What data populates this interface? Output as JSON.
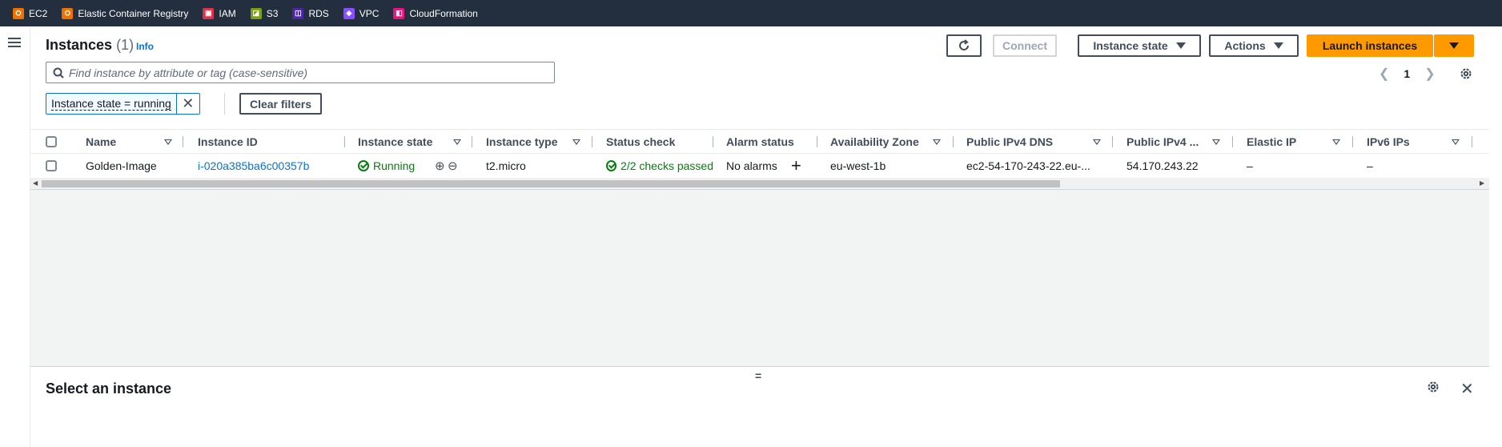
{
  "favorites": [
    {
      "label": "EC2",
      "color": "#ed7100"
    },
    {
      "label": "Elastic Container Registry",
      "color": "#ed7100"
    },
    {
      "label": "IAM",
      "color": "#dd344c"
    },
    {
      "label": "S3",
      "color": "#7aa116"
    },
    {
      "label": "RDS",
      "color": "#4d27aa"
    },
    {
      "label": "VPC",
      "color": "#8c4fff"
    },
    {
      "label": "CloudFormation",
      "color": "#e7157b"
    }
  ],
  "header": {
    "title": "Instances",
    "count": "(1)",
    "info": "Info",
    "connect_label": "Connect",
    "instance_state_label": "Instance state",
    "actions_label": "Actions",
    "launch_label": "Launch instances"
  },
  "search": {
    "placeholder": "Find instance by attribute or tag (case-sensitive)"
  },
  "pagination": {
    "page": "1"
  },
  "filter": {
    "token": "Instance state = running",
    "clear_label": "Clear filters"
  },
  "table": {
    "headers": {
      "name": "Name",
      "instance_id": "Instance ID",
      "instance_state": "Instance state",
      "instance_type": "Instance type",
      "status_check": "Status check",
      "alarm_status": "Alarm status",
      "availability_zone": "Availability Zone",
      "public_dns": "Public IPv4 DNS",
      "public_ip": "Public IPv4 ...",
      "elastic_ip": "Elastic IP",
      "ipv6": "IPv6 IPs"
    },
    "row": {
      "name": "Golden-Image",
      "instance_id": "i-020a385ba6c00357b",
      "instance_state": "Running",
      "instance_type": "t2.micro",
      "status_check": "2/2 checks passed",
      "alarm_status": "No alarms",
      "availability_zone": "eu-west-1b",
      "public_dns": "ec2-54-170-243-22.eu-...",
      "public_ip": "54.170.243.22",
      "elastic_ip": "–",
      "ipv6": "–"
    }
  },
  "split_panel": {
    "title": "Select an instance",
    "handle": "="
  },
  "colors": {
    "accent": "#0972d3",
    "primary_button": "#ff9900",
    "success": "#037f0c",
    "nav_bg": "#232f3e"
  }
}
